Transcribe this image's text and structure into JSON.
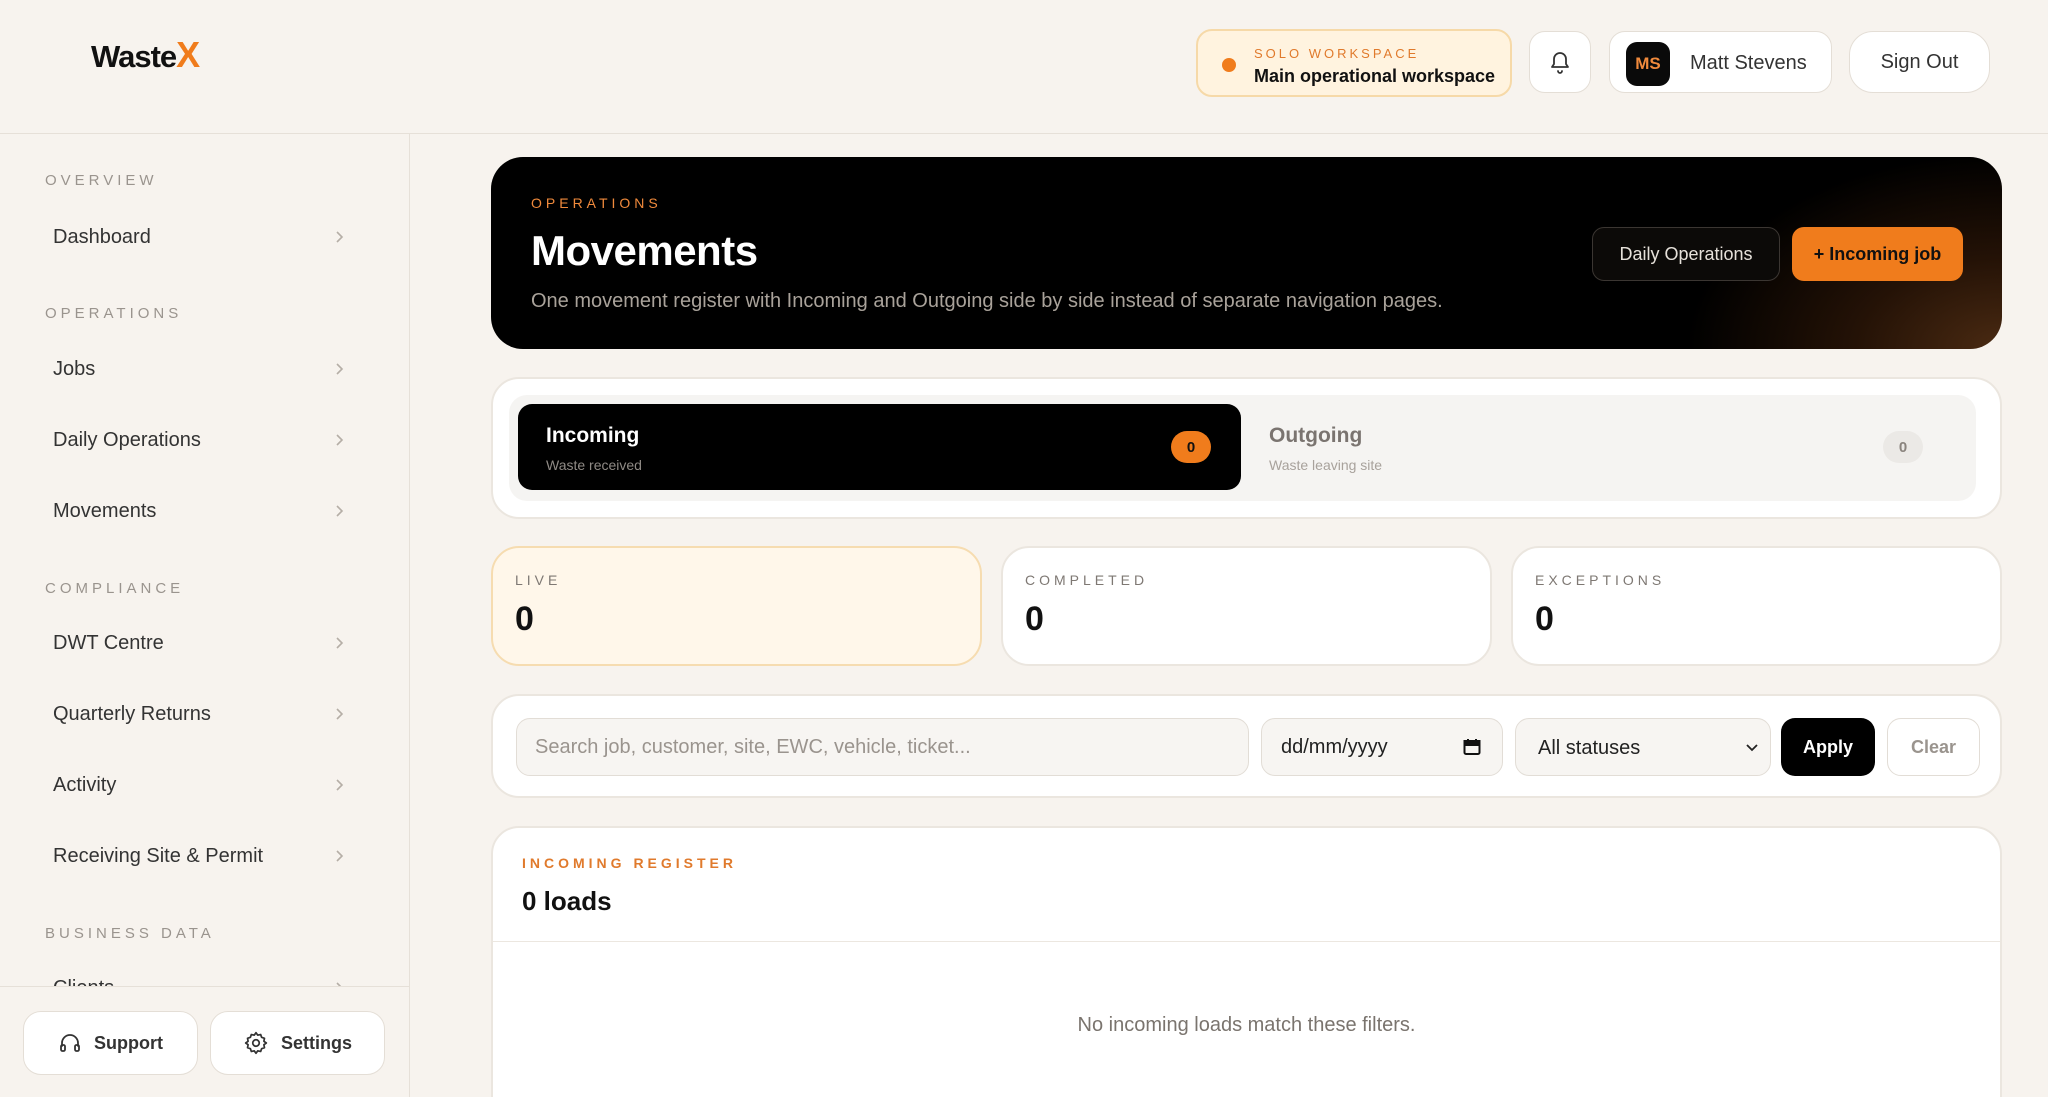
{
  "header": {
    "logo_text": "Waste",
    "logo_accent": "X",
    "workspace": {
      "label": "SOLO WORKSPACE",
      "name": "Main operational workspace"
    },
    "user": {
      "initials": "MS",
      "name": "Matt Stevens"
    },
    "sign_out_label": "Sign Out"
  },
  "sidebar": {
    "sections": {
      "overview": "OVERVIEW",
      "operations": "OPERATIONS",
      "compliance": "COMPLIANCE",
      "business_data": "BUSINESS DATA"
    },
    "items": [
      {
        "label": "Dashboard"
      },
      {
        "label": "Jobs"
      },
      {
        "label": "Daily Operations"
      },
      {
        "label": "Movements"
      },
      {
        "label": "DWT Centre"
      },
      {
        "label": "Quarterly Returns"
      },
      {
        "label": "Activity"
      },
      {
        "label": "Receiving Site & Permit"
      },
      {
        "label": "Clients"
      }
    ],
    "footer": {
      "support_label": "Support",
      "settings_label": "Settings"
    }
  },
  "hero": {
    "eyebrow": "OPERATIONS",
    "title": "Movements",
    "subtitle": "One movement register with Incoming and Outgoing side by side instead of separate navigation pages.",
    "daily_ops_label": "Daily Operations",
    "incoming_job_label": "+ Incoming job"
  },
  "tabs": [
    {
      "label": "Incoming",
      "sub": "Waste received",
      "count": "0",
      "active": true
    },
    {
      "label": "Outgoing",
      "sub": "Waste leaving site",
      "count": "0",
      "active": false
    }
  ],
  "stats": {
    "live": {
      "label": "LIVE",
      "value": "0"
    },
    "completed": {
      "label": "COMPLETED",
      "value": "0"
    },
    "exceptions": {
      "label": "EXCEPTIONS",
      "value": "0"
    }
  },
  "filters": {
    "search_placeholder": "Search job, customer, site, EWC, vehicle, ticket...",
    "date_placeholder": "dd/mm/yyyy",
    "status_value": "All statuses",
    "apply_label": "Apply",
    "clear_label": "Clear"
  },
  "register": {
    "eyebrow": "INCOMING REGISTER",
    "title": "0 loads",
    "empty_message": "No incoming loads match these filters."
  },
  "colors": {
    "accent": "#f07c1c",
    "background": "#f7f3ee",
    "dark": "#000000"
  }
}
